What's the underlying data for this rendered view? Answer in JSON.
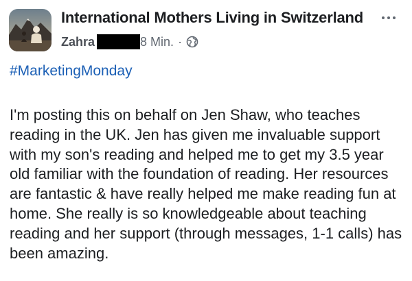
{
  "post": {
    "group_name": "International Mothers Living in Switzerland",
    "author": "Zahra",
    "time": "8 Min.",
    "separator": "·",
    "audience_icon": "globe-icon",
    "hashtag": "#MarketingMonday",
    "body": "I'm posting this on behalf on Jen Shaw, who teaches reading in the UK. Jen has given me invaluable support with my son's reading and helped me to get my 3.5 year old familiar with the foundation of reading. Her resources are fantastic & have really helped me make reading fun at home. She really is so knowledgeable about teaching reading and her support (through messages, 1-1 calls) has been amazing.",
    "more_icon": "more-options-icon",
    "colors": {
      "text": "#1c1e21",
      "secondary": "#606770",
      "hashtag": "#1b5fb5",
      "redaction": "#000000"
    }
  }
}
